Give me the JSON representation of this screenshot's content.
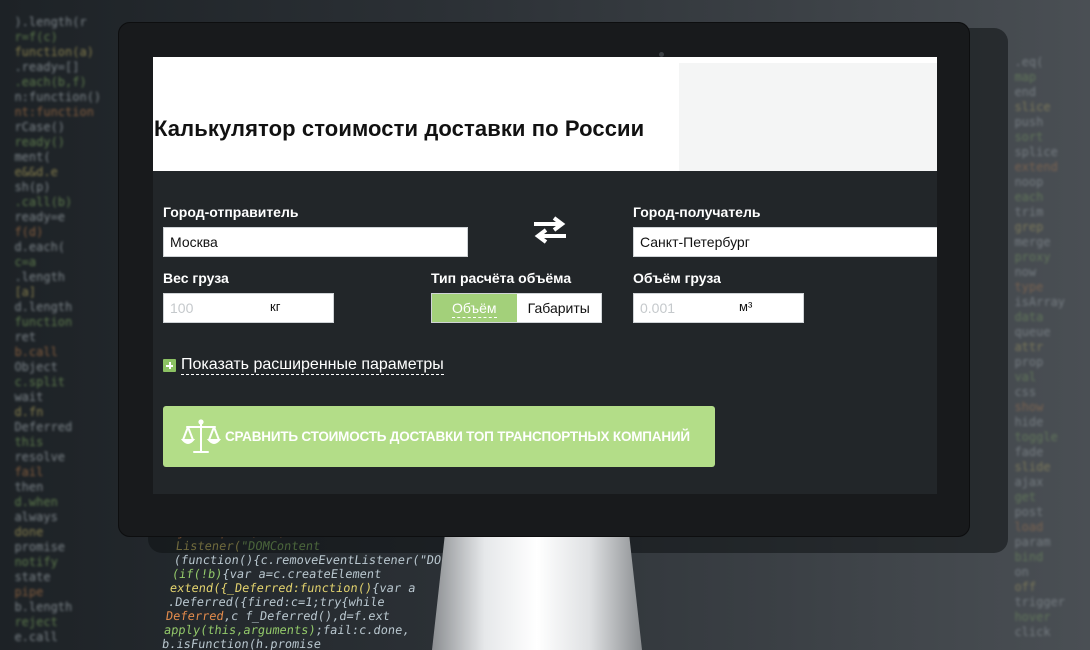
{
  "title": "Калькулятор стоимости доставки по России",
  "sender": {
    "label": "Город-отправитель",
    "value": "Москва"
  },
  "receiver": {
    "label": "Город-получатель",
    "value": "Санкт-Петербург"
  },
  "weight": {
    "label": "Вес груза",
    "placeholder": "100",
    "unit": "кг"
  },
  "volume_type": {
    "label": "Тип расчёта объёма",
    "options": [
      "Объём",
      "Габариты"
    ],
    "selected": "Объём"
  },
  "volume": {
    "label": "Объём груза",
    "placeholder": "0.001",
    "unit": "м³"
  },
  "advanced": {
    "label": "Показать расширенные параметры"
  },
  "cta": {
    "label": "Сравнить стоимость доставки топ транспортных компаний"
  },
  "colors": {
    "accent": "#a3d07a",
    "button": "#b3dd88",
    "panel": "#222629"
  },
  "icons": {
    "swap": "swap-arrows-icon",
    "scales": "scales-icon",
    "plus": "plus-icon"
  }
}
